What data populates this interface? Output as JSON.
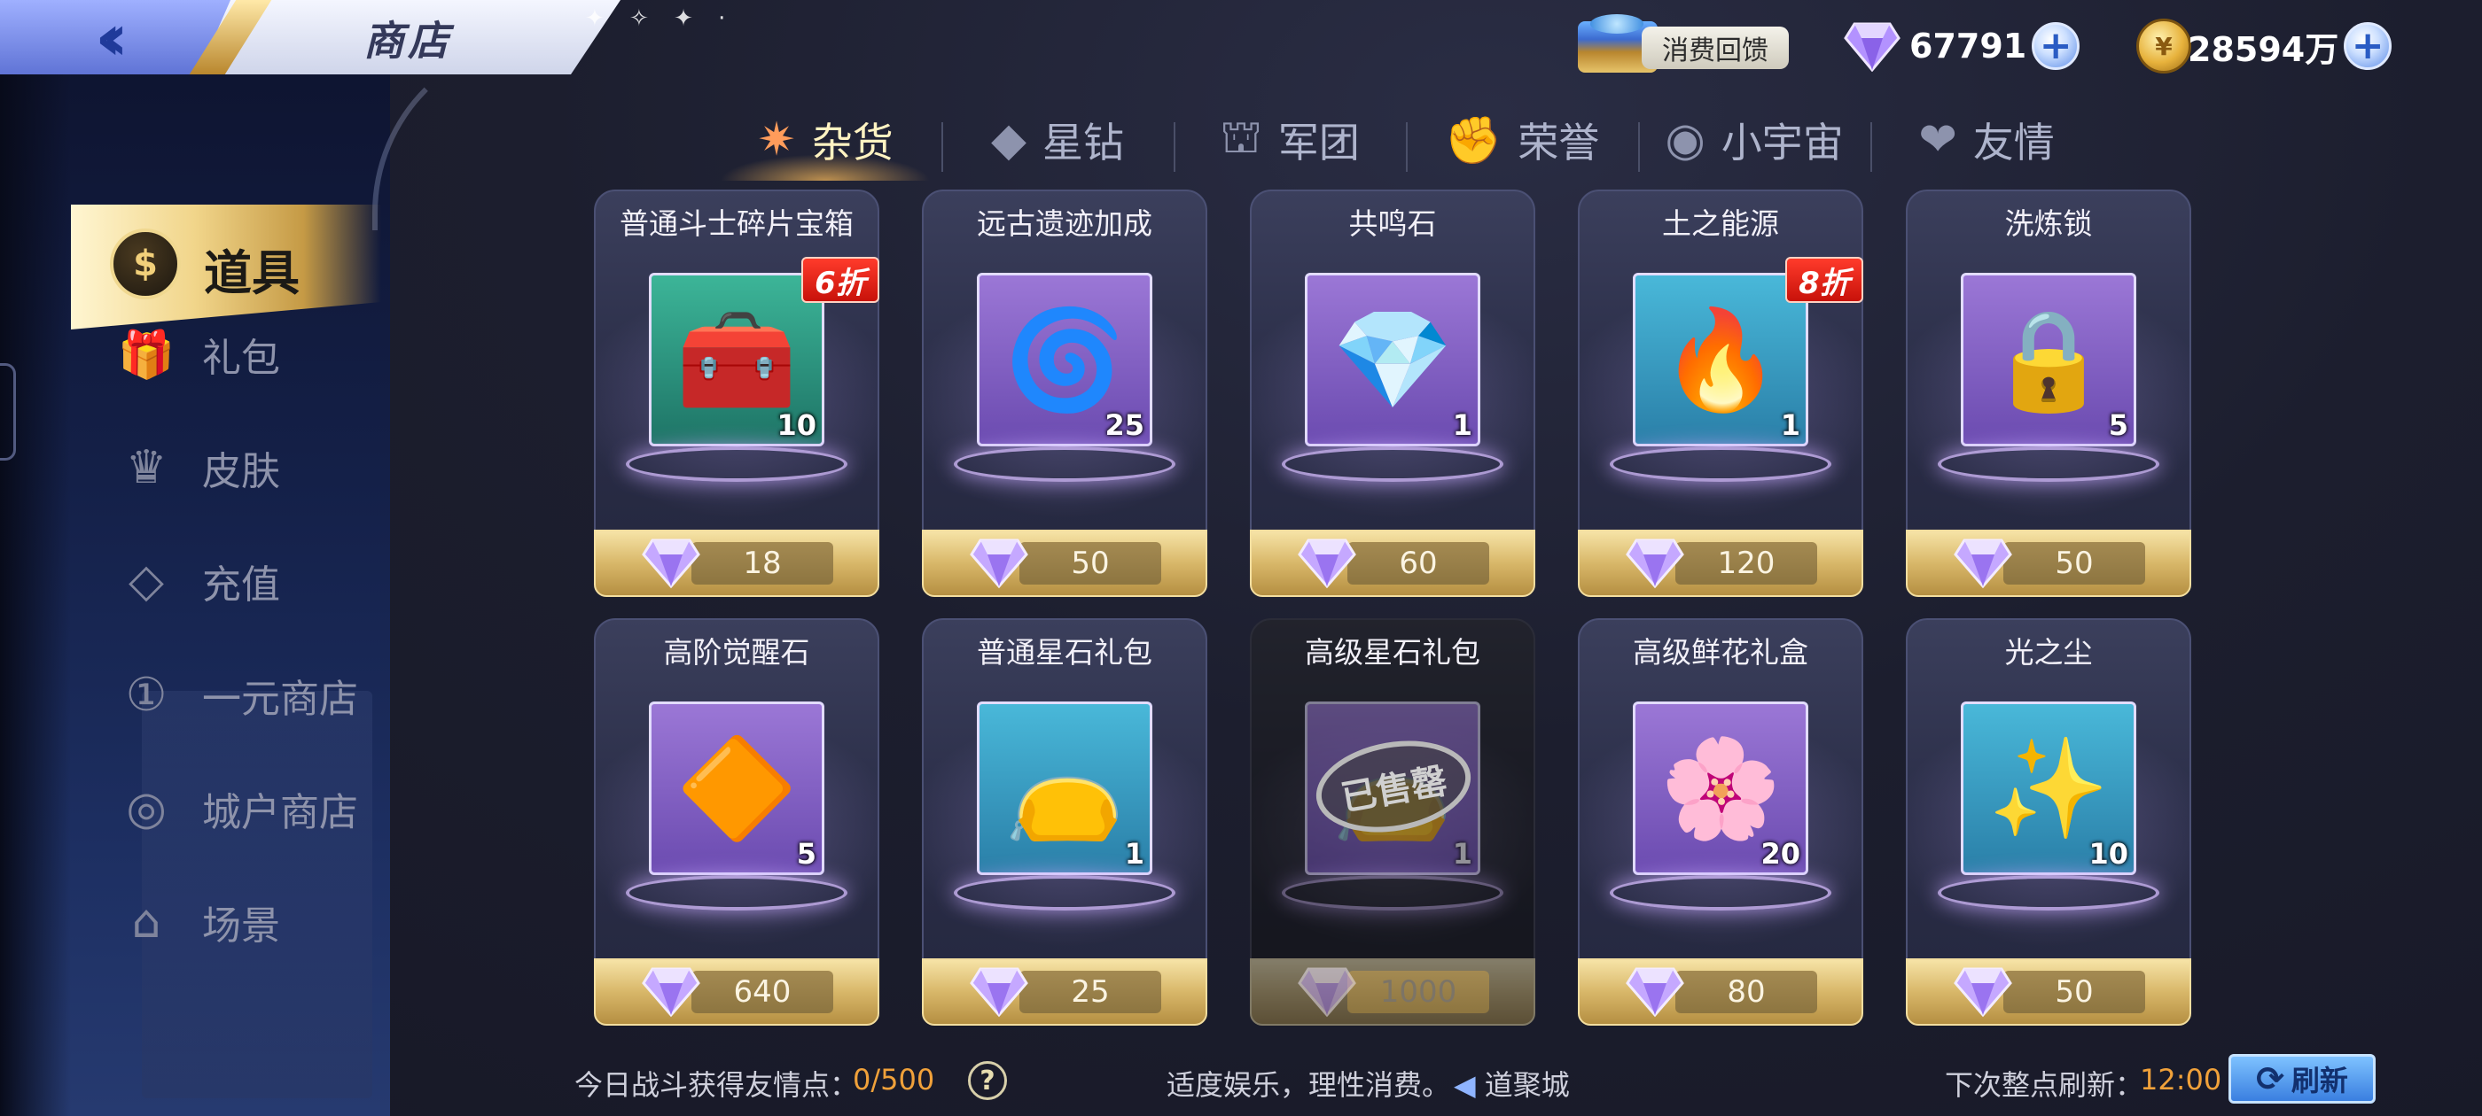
{
  "header": {
    "title": "商店",
    "feedback_label": "消费回馈",
    "gems": "67791",
    "coins": "28594万"
  },
  "tabs": [
    {
      "label": "杂货",
      "icon": "✷",
      "active": true
    },
    {
      "label": "星钻",
      "icon": "◆",
      "active": false
    },
    {
      "label": "军团",
      "icon": "⛫",
      "active": false
    },
    {
      "label": "荣誉",
      "icon": "✊",
      "active": false
    },
    {
      "label": "小宇宙",
      "icon": "◉",
      "active": false
    },
    {
      "label": "友情",
      "icon": "❤",
      "active": false
    }
  ],
  "sidebar": {
    "active_label": "道具",
    "items": [
      {
        "label": "礼包",
        "icon": "🎁"
      },
      {
        "label": "皮肤",
        "icon": "♛"
      },
      {
        "label": "充值",
        "icon": "◇"
      },
      {
        "label": "一元商店",
        "icon": "①"
      },
      {
        "label": "城户商店",
        "icon": "◎"
      },
      {
        "label": "场景",
        "icon": "⌂"
      }
    ]
  },
  "items": [
    {
      "name": "普通斗士碎片宝箱",
      "qty": "10",
      "price": "18",
      "discount": "6折",
      "art": "green",
      "glyph": "🧰"
    },
    {
      "name": "远古遗迹加成",
      "qty": "25",
      "price": "50",
      "discount": "",
      "art": "purple",
      "glyph": "🌀"
    },
    {
      "name": "共鸣石",
      "qty": "1",
      "price": "60",
      "discount": "",
      "art": "purple",
      "glyph": "💎"
    },
    {
      "name": "土之能源",
      "qty": "1",
      "price": "120",
      "discount": "8折",
      "art": "teal",
      "glyph": "🔥"
    },
    {
      "name": "洗炼锁",
      "qty": "5",
      "price": "50",
      "discount": "",
      "art": "purple",
      "glyph": "🔒"
    },
    {
      "name": "高阶觉醒石",
      "qty": "5",
      "price": "640",
      "discount": "",
      "art": "purple",
      "glyph": "🔶"
    },
    {
      "name": "普通星石礼包",
      "qty": "1",
      "price": "25",
      "discount": "",
      "art": "teal",
      "glyph": "👝"
    },
    {
      "name": "高级星石礼包",
      "qty": "1",
      "price": "1000",
      "discount": "",
      "art": "purple",
      "glyph": "👝",
      "sold_out": "已售罄"
    },
    {
      "name": "高级鲜花礼盒",
      "qty": "20",
      "price": "80",
      "discount": "",
      "art": "purple",
      "glyph": "🌸"
    },
    {
      "name": "光之尘",
      "qty": "10",
      "price": "50",
      "discount": "",
      "art": "teal",
      "glyph": "✨"
    }
  ],
  "footer": {
    "friend_points_label": "今日战斗获得友情点：",
    "friend_points_value": "0/500",
    "help": "?",
    "notice": "适度娱乐，理性消费。",
    "brand": "道聚城",
    "next_refresh_label": "下次整点刷新：",
    "next_refresh_time": "12:00",
    "refresh_label": "刷新"
  },
  "colors": {
    "accent_gold": "#d8b769",
    "discount_red": "#e0241a",
    "refresh_blue": "#3a7fe0",
    "time_orange": "#f0a13a"
  }
}
